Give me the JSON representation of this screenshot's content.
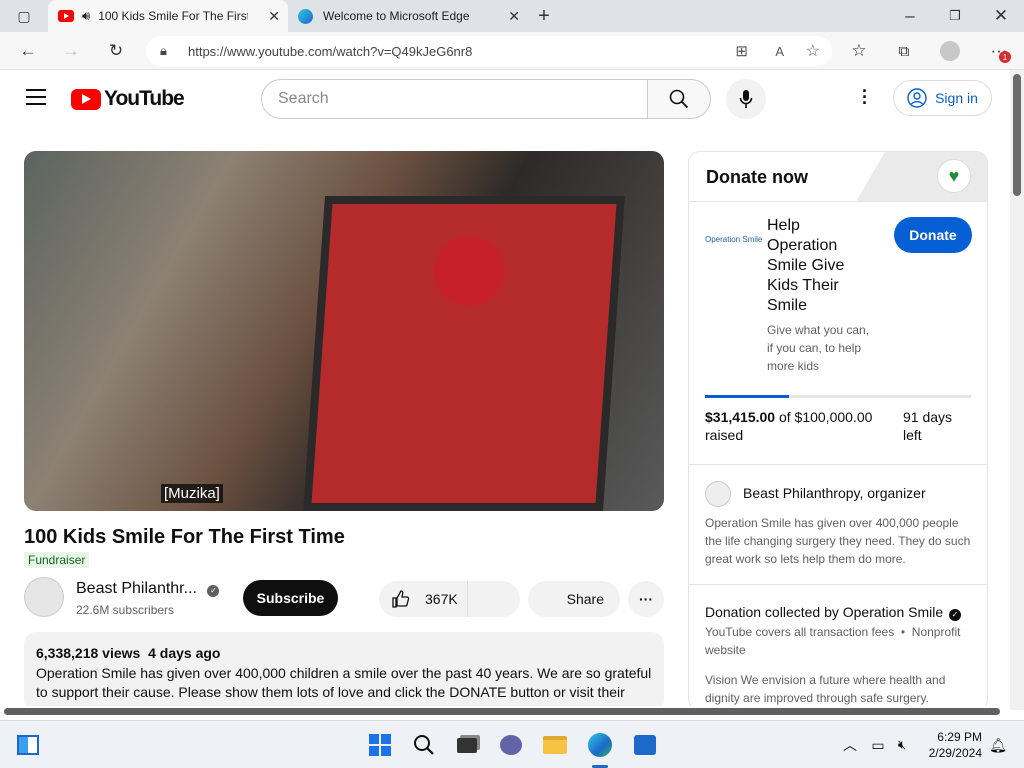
{
  "browser": {
    "tabs": [
      {
        "title": "100 Kids Smile For The First"
      },
      {
        "title": "Welcome to Microsoft Edge"
      }
    ],
    "url": "https://www.youtube.com/watch?v=Q49kJeG6nr8",
    "notification_count": "1"
  },
  "youtube": {
    "logo_text": "YouTube",
    "search_placeholder": "Search",
    "sign_in": "Sign in"
  },
  "video": {
    "caption": "[Muzika]",
    "title": "100 Kids Smile For The First Time",
    "badge": "Fundraiser",
    "channel": "Beast Philanthr...",
    "subscribers": "22.6M subscribers",
    "subscribe": "Subscribe",
    "likes": "367K",
    "share": "Share",
    "views": "6,338,218 views",
    "age": "4 days ago",
    "description": "Operation Smile has given over 400,000 children a smile over the past 40 years. We are so grateful to support their cause. Please show them lots of love and click the DONATE button or visit their"
  },
  "donation": {
    "header": "Donate now",
    "org_logo": "Operation Smile",
    "campaign_title": "Help Operation Smile Give Kids Their Smile",
    "campaign_sub": "Give what you can, if you can, to help more kids",
    "donate_button": "Donate",
    "raised_amount": "$31,415.00",
    "goal_text": "of $100,000.00",
    "raised_word": "raised",
    "days_left": "91 days",
    "days_left_word": "left",
    "progress_fraction": 0.314,
    "organizer_name": "Beast Philanthropy",
    "organizer_role": ", organizer",
    "organizer_text": "Operation Smile has given over 400,000 people the life changing surgery they need. They do such great work so lets help them do more.",
    "collected_by": "Donation collected by Operation Smile",
    "fees": "YouTube covers all transaction fees",
    "nonprofit": "Nonprofit website",
    "vision": "Vision We envision a future where health and dignity are improved through safe surgery."
  },
  "taskbar": {
    "time": "6:29 PM",
    "date": "2/29/2024"
  },
  "colors": {
    "youtube_red": "#ff0000",
    "donate_blue": "#065fd4",
    "progress_blue": "#065fd4"
  }
}
